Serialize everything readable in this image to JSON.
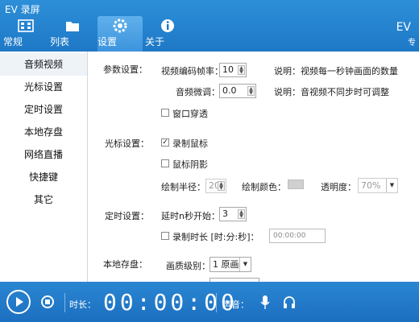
{
  "window": {
    "title": "EV 录屏",
    "brand": "EV",
    "brand_sub": "专"
  },
  "tabs": [
    {
      "label": "常规",
      "icon": "film-icon"
    },
    {
      "label": "列表",
      "icon": "folder-icon"
    },
    {
      "label": "设置",
      "icon": "gear-icon"
    },
    {
      "label": "关于",
      "icon": "info-icon"
    }
  ],
  "sidebar": {
    "items": [
      "音频视频",
      "光标设置",
      "定时设置",
      "本地存盘",
      "网络直播",
      "快捷键",
      "其它"
    ]
  },
  "params": {
    "section": "参数设置：",
    "fps_label": "视频编码帧率：",
    "fps_value": "10",
    "fps_note": "说明：视频每一秒钟画面的数量",
    "audio_label": "音频微调：",
    "audio_value": "0.0",
    "audio_note": "说明：音视频不同步时可调整",
    "window_pass_label": "窗口穿透"
  },
  "cursor": {
    "section": "光标设置：",
    "record_label": "录制鼠标",
    "shadow_label": "鼠标阴影",
    "radius_label": "绘制半径：",
    "radius_value": "20",
    "color_label": "绘制颜色：",
    "opacity_label": "透明度：",
    "opacity_value": "70%"
  },
  "timer": {
    "section": "定时设置：",
    "delay_label": "延时n秒开始：",
    "delay_value": "3",
    "duration_label": "录制时长 [时:分:秒]：",
    "duration_value": "00:00:00"
  },
  "storage": {
    "section": "本地存盘：",
    "quality_label": "画质级别：",
    "quality_value": "1 原画"
  },
  "bottom": {
    "duration_label": "时长：",
    "timer_display": "00:00:00",
    "sound_label": "声音："
  },
  "colors": {
    "accent": "#1e78c6",
    "bar": "#2a86d2"
  }
}
